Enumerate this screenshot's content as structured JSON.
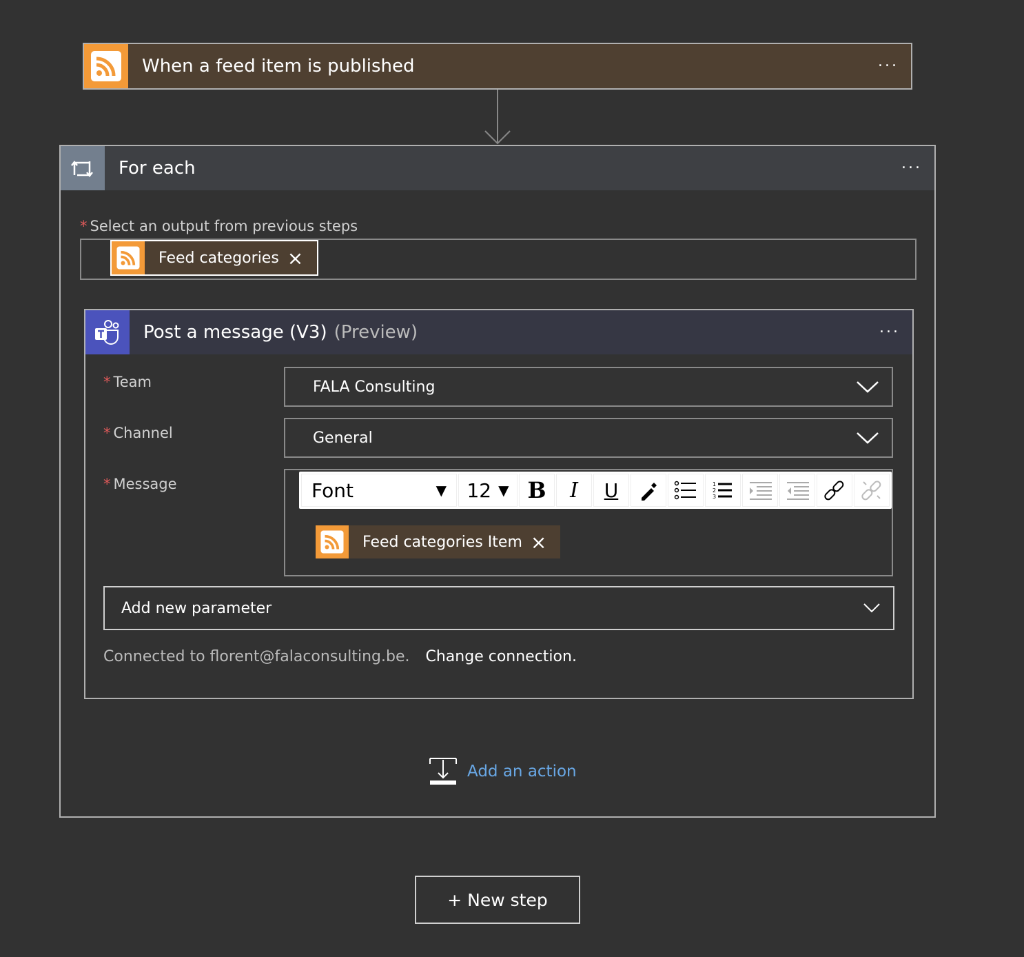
{
  "trigger": {
    "title": "When a feed item is published",
    "icon": "rss-icon",
    "more": "···"
  },
  "foreach": {
    "title": "For each",
    "icon": "loop-icon",
    "more": "···",
    "select_label": "Select an output from previous steps",
    "token": {
      "label": "Feed categories",
      "remove": "×"
    }
  },
  "action": {
    "title": "Post a message (V3)",
    "preview": "(Preview)",
    "icon": "teams-icon",
    "more": "···",
    "fields": {
      "team": {
        "label": "Team",
        "value": "FALA Consulting"
      },
      "channel": {
        "label": "Channel",
        "value": "General"
      },
      "message": {
        "label": "Message"
      }
    },
    "toolbar": {
      "font": "Font",
      "size": "12",
      "bold": "B",
      "italic": "I",
      "underline": "U"
    },
    "message_token": {
      "label": "Feed categories Item",
      "remove": "×"
    },
    "add_param": "Add new parameter",
    "connected": "Connected to florent@falaconsulting.be.",
    "change": "Change connection."
  },
  "add_action": "Add an action",
  "new_step": "+ New step",
  "colors": {
    "bg": "#323232",
    "rss": "#f39a38",
    "trigger_head": "#4f4031",
    "foreach_head": "#3e4044",
    "teams": "#4b53bc",
    "teams_head": "#363744",
    "link": "#69a8e6"
  }
}
